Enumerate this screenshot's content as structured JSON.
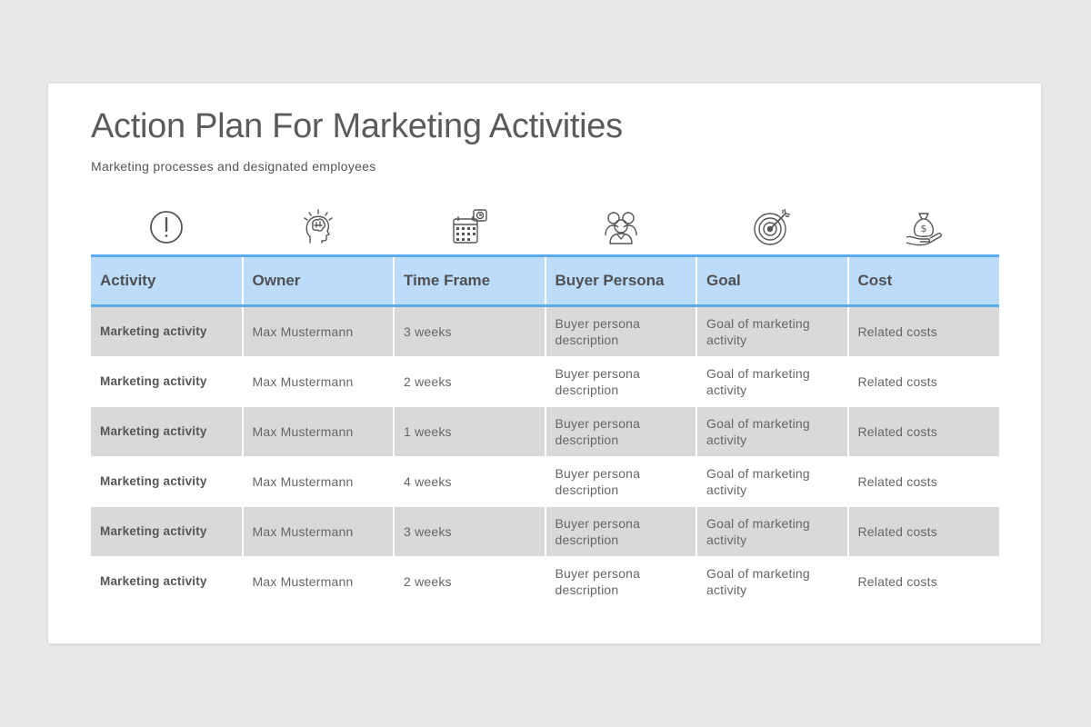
{
  "slide": {
    "title": "Action Plan For Marketing Activities",
    "subtitle": "Marketing processes and designated employees"
  },
  "icons": [
    {
      "name": "exclamation-circle-icon"
    },
    {
      "name": "brain-head-icon"
    },
    {
      "name": "calendar-clock-icon"
    },
    {
      "name": "people-group-icon"
    },
    {
      "name": "target-arrow-icon"
    },
    {
      "name": "money-bag-hand-icon"
    }
  ],
  "colors": {
    "header_bg": "#bcdcfa",
    "header_border": "#5aaaf0",
    "row_alt_bg": "#d9d9d9",
    "text": "#5a5b5d"
  },
  "table": {
    "headers": [
      "Activity",
      "Owner",
      "Time Frame",
      "Buyer Persona",
      "Goal",
      "Cost"
    ],
    "rows": [
      [
        "Marketing activity",
        "Max Mustermann",
        "3 weeks",
        "Buyer persona description",
        "Goal of marketing activity",
        "Related costs"
      ],
      [
        "Marketing activity",
        "Max Mustermann",
        "2 weeks",
        "Buyer persona description",
        "Goal of marketing activity",
        "Related costs"
      ],
      [
        "Marketing activity",
        "Max Mustermann",
        "1 weeks",
        "Buyer persona description",
        "Goal of marketing activity",
        "Related costs"
      ],
      [
        "Marketing activity",
        "Max Mustermann",
        "4 weeks",
        "Buyer persona description",
        "Goal of marketing activity",
        "Related costs"
      ],
      [
        "Marketing activity",
        "Max Mustermann",
        "3 weeks",
        "Buyer persona description",
        "Goal of marketing activity",
        "Related costs"
      ],
      [
        "Marketing activity",
        "Max Mustermann",
        "2 weeks",
        "Buyer persona description",
        "Goal of marketing activity",
        "Related costs"
      ]
    ]
  }
}
